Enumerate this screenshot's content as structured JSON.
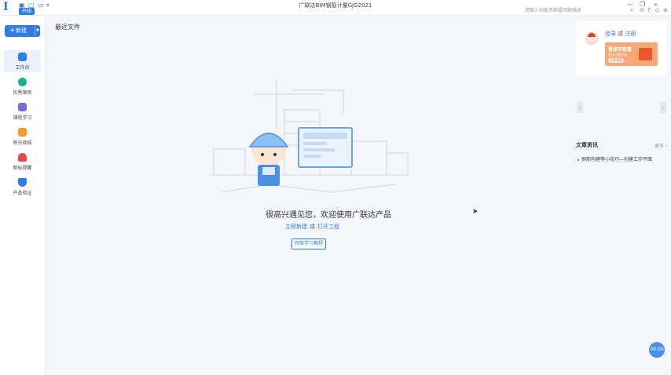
{
  "titlebar": {
    "logo": "I",
    "start_label": "开始",
    "window_title": "广联达BIM钢筋计量GJG2021",
    "search_placeholder": "请输入功能名称或问题描述",
    "minimize": "—",
    "restore": "❐",
    "more": "»"
  },
  "sidebar": {
    "new_label": "新建",
    "items": [
      {
        "label": "工作台",
        "color": "#2e7ce8"
      },
      {
        "label": "优秀案例",
        "color": "#1fae8e"
      },
      {
        "label": "课程学习",
        "color": "#6f6fe0"
      },
      {
        "label": "积分商城",
        "color": "#f39a2e"
      },
      {
        "label": "新标提醒",
        "color": "#e2484c"
      },
      {
        "label": "产品验证",
        "color": "#2e7ce8"
      }
    ]
  },
  "main": {
    "section_title": "最近文件",
    "greeting": "很高兴遇见您，欢迎使用广联达产品",
    "link_new": "立即新建",
    "link_or": "或",
    "link_open": "打开工程",
    "tutorial_button": "获取学习教程"
  },
  "right_panel": {
    "login": "登录",
    "or": "或",
    "register": "注册",
    "promo_title": "登录有惊喜",
    "promo_sub": "积分领好礼",
    "promo_cta": "立即领取",
    "arrow_left": "‹",
    "arrow_right": "›",
    "news_title": "文章资讯",
    "more": "更多 ›",
    "news_items": [
      "钢筋构建等小技巧—创建工作平面"
    ]
  },
  "float_button": "00:00",
  "colors": {
    "accent": "#2e7ce8",
    "background": "#f4f6f9"
  }
}
